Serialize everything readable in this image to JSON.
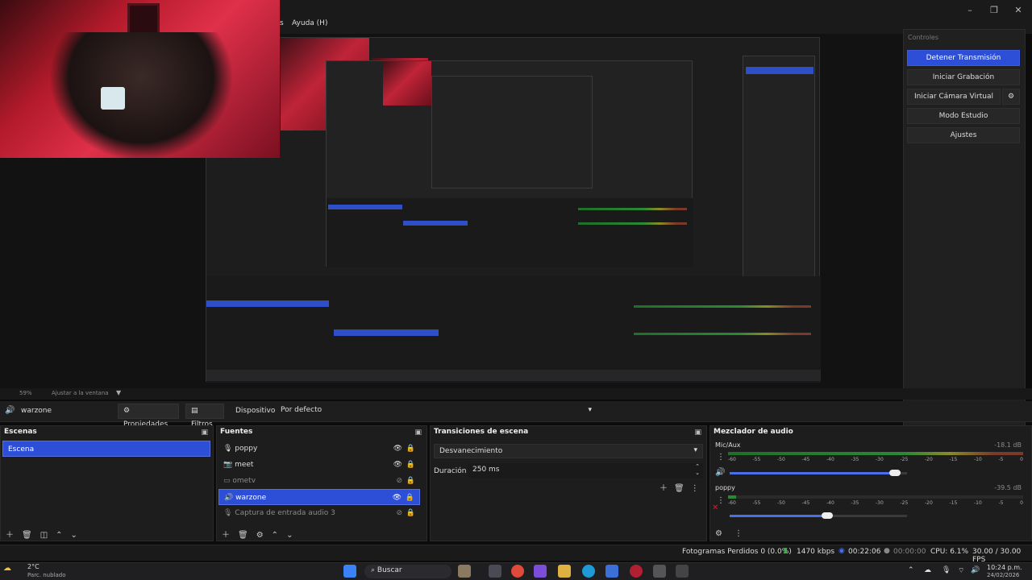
{
  "menu": {
    "partial": "s",
    "help": "Ayuda (H)"
  },
  "controls": {
    "title": "Controles",
    "stop_stream": "Detener Transmisión",
    "start_recording": "Iniciar Grabación",
    "start_virtual_cam": "Iniciar Cámara Virtual",
    "studio_mode": "Modo Estudio",
    "settings": "Ajustes"
  },
  "preview_status": {
    "zoom": "59%",
    "fit": "Ajustar a la ventana"
  },
  "source_bar": {
    "current_source": "warzone",
    "properties": "Propiedades",
    "filters": "Filtros",
    "device_label": "Dispositivo",
    "device_value": "Por defecto"
  },
  "scenes": {
    "title": "Escenas",
    "items": [
      "Escena"
    ]
  },
  "sources": {
    "title": "Fuentes",
    "items": [
      {
        "name": "poppy"
      },
      {
        "name": "meet"
      },
      {
        "name": "ometv"
      },
      {
        "name": "warzone"
      },
      {
        "name": "Captura de entrada audio 3"
      }
    ]
  },
  "transitions": {
    "title": "Transiciones de escena",
    "type": "Desvanecimiento",
    "duration_label": "Duración",
    "duration_value": "250 ms"
  },
  "mixer": {
    "title": "Mezclador de audio",
    "tracks": [
      {
        "name": "Mic/Aux",
        "level": "-18.1 dB",
        "volume": 0.93
      },
      {
        "name": "poppy",
        "level": "-39.5 dB",
        "volume": 0.55
      }
    ],
    "scale": [
      "-60",
      "-55",
      "-50",
      "-45",
      "-40",
      "-35",
      "-30",
      "-25",
      "-20",
      "-15",
      "-10",
      "-5",
      "0"
    ]
  },
  "status": {
    "dropped_frames": "Fotogramas Perdidos 0 (0.0%)",
    "bitrate": "1470 kbps",
    "stream_time": "00:22:06",
    "rec_time": "00:00:00",
    "cpu": "CPU: 6.1%",
    "fps": "30.00 / 30.00 FPS"
  },
  "taskbar": {
    "weather_temp": "2°C",
    "weather_desc": "Parc. nublado",
    "search": "Buscar",
    "time": "10:24 p.m.",
    "date": "24/02/2026"
  },
  "colors": {
    "accent": "#2d4ed6",
    "panel": "#1d1d1d",
    "background": "#121212"
  }
}
